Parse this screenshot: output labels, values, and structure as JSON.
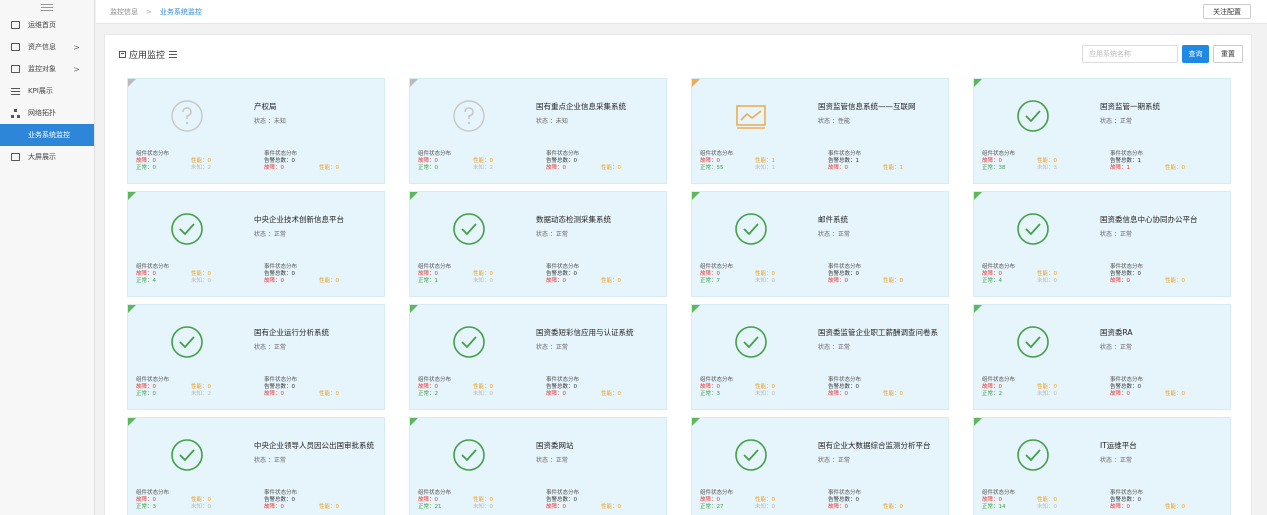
{
  "sidebar": {
    "items": [
      {
        "label": "运维首页",
        "icon": "checkbox-icon",
        "arrow": false
      },
      {
        "label": "资产信息",
        "icon": "camera-icon",
        "arrow": true
      },
      {
        "label": "监控对象",
        "icon": "monitor-icon",
        "arrow": true
      },
      {
        "label": "KPI展示",
        "icon": "list-icon",
        "arrow": false
      },
      {
        "label": "网络拓扑",
        "icon": "topology-icon",
        "arrow": false
      },
      {
        "label": "业务系统监控",
        "icon": "grid-icon",
        "arrow": false,
        "active": true
      },
      {
        "label": "大屏展示",
        "icon": "screen-icon",
        "arrow": false
      }
    ],
    "arrow_glyph": ">"
  },
  "topbar": {
    "breadcrumb_root": "监控信息",
    "breadcrumb_sep": ">",
    "breadcrumb_current": "业务系统监控",
    "follow_button": "关注配置"
  },
  "panel": {
    "title": "应用监控",
    "search_placeholder": "应用系统名称",
    "query_button": "查询",
    "reset_button": "重置"
  },
  "labels": {
    "component_dist": "组件状态分布",
    "event_dist": "事件状态分布",
    "fault": "故障：",
    "perf": "性能：",
    "normal": "正常：",
    "unknown": "未知：",
    "alarm": "告警总数：",
    "fault_bold": "故障："
  },
  "colors": {
    "accent": "#2e86d9",
    "normal": "#5cb85c",
    "unknown": "#bbbbbb",
    "performance": "#f0ad4e",
    "fault": "#e53935"
  },
  "cards": [
    {
      "name": "产权局",
      "status": "状态 ：未知",
      "state": "unknown",
      "c_fault": "0",
      "c_perf": "0",
      "c_normal": "0",
      "c_unknown": "2",
      "e_alarm": "0",
      "e_fault": "0",
      "e_perf": "0"
    },
    {
      "name": "国有重点企业信息采集系统",
      "status": "状态 ：未知",
      "state": "unknown",
      "c_fault": "0",
      "c_perf": "0",
      "c_normal": "0",
      "c_unknown": "2",
      "e_alarm": "0",
      "e_fault": "0",
      "e_perf": "0"
    },
    {
      "name": "国资监管信息系统——互联网",
      "status": "状态 ：性能",
      "state": "perf",
      "c_fault": "0",
      "c_perf": "1",
      "c_normal": "55",
      "c_unknown": "1",
      "e_alarm": "1",
      "e_fault": "0",
      "e_perf": "1"
    },
    {
      "name": "国资监管一期系统",
      "status": "状态 ：正常",
      "state": "normal",
      "c_fault": "0",
      "c_perf": "0",
      "c_normal": "38",
      "c_unknown": "3",
      "e_alarm": "1",
      "e_fault": "1",
      "e_perf": "0"
    },
    {
      "name": "中央企业技术创新信息平台",
      "status": "状态 ：正常",
      "state": "normal",
      "c_fault": "0",
      "c_perf": "0",
      "c_normal": "4",
      "c_unknown": "0",
      "e_alarm": "0",
      "e_fault": "0",
      "e_perf": "0"
    },
    {
      "name": "数据动态检测采集系统",
      "status": "状态 ：正常",
      "state": "normal",
      "c_fault": "0",
      "c_perf": "0",
      "c_normal": "1",
      "c_unknown": "0",
      "e_alarm": "0",
      "e_fault": "0",
      "e_perf": "0"
    },
    {
      "name": "邮件系统",
      "status": "状态 ：正常",
      "state": "normal",
      "c_fault": "0",
      "c_perf": "0",
      "c_normal": "7",
      "c_unknown": "0",
      "e_alarm": "0",
      "e_fault": "0",
      "e_perf": "0"
    },
    {
      "name": "国资委信息中心协同办公平台",
      "status": "状态 ：正常",
      "state": "normal",
      "c_fault": "0",
      "c_perf": "0",
      "c_normal": "4",
      "c_unknown": "0",
      "e_alarm": "0",
      "e_fault": "0",
      "e_perf": "0"
    },
    {
      "name": "国有企业运行分析系统",
      "status": "状态 ：正常",
      "state": "normal",
      "c_fault": "0",
      "c_perf": "0",
      "c_normal": "0",
      "c_unknown": "2",
      "e_alarm": "0",
      "e_fault": "0",
      "e_perf": "0"
    },
    {
      "name": "国资委短彩信应用与认证系统",
      "status": "状态 ：正常",
      "state": "normal",
      "c_fault": "0",
      "c_perf": "0",
      "c_normal": "2",
      "c_unknown": "0",
      "e_alarm": "0",
      "e_fault": "0",
      "e_perf": "0"
    },
    {
      "name": "国资委监管企业职工薪酬调查问卷系",
      "status": "状态 ：正常",
      "state": "normal",
      "c_fault": "0",
      "c_perf": "0",
      "c_normal": "3",
      "c_unknown": "0",
      "e_alarm": "0",
      "e_fault": "0",
      "e_perf": "0"
    },
    {
      "name": "国资委RA",
      "status": "状态 ：正常",
      "state": "normal",
      "c_fault": "0",
      "c_perf": "0",
      "c_normal": "2",
      "c_unknown": "0",
      "e_alarm": "0",
      "e_fault": "0",
      "e_perf": "0"
    },
    {
      "name": "中央企业领导人员因公出国审批系统",
      "status": "状态 ：正常",
      "state": "normal",
      "c_fault": "0",
      "c_perf": "0",
      "c_normal": "3",
      "c_unknown": "0",
      "e_alarm": "0",
      "e_fault": "0",
      "e_perf": "0"
    },
    {
      "name": "国资委网站",
      "status": "状态 ：正常",
      "state": "normal",
      "c_fault": "0",
      "c_perf": "0",
      "c_normal": "21",
      "c_unknown": "0",
      "e_alarm": "0",
      "e_fault": "0",
      "e_perf": "0"
    },
    {
      "name": "国有企业大数据综合监测分析平台",
      "status": "状态 ：正常",
      "state": "normal",
      "c_fault": "0",
      "c_perf": "0",
      "c_normal": "27",
      "c_unknown": "0",
      "e_alarm": "0",
      "e_fault": "0",
      "e_perf": "0"
    },
    {
      "name": "IT运维平台",
      "status": "状态 ：正常",
      "state": "normal",
      "c_fault": "0",
      "c_perf": "0",
      "c_normal": "14",
      "c_unknown": "0",
      "e_alarm": "0",
      "e_fault": "0",
      "e_perf": "0"
    }
  ]
}
